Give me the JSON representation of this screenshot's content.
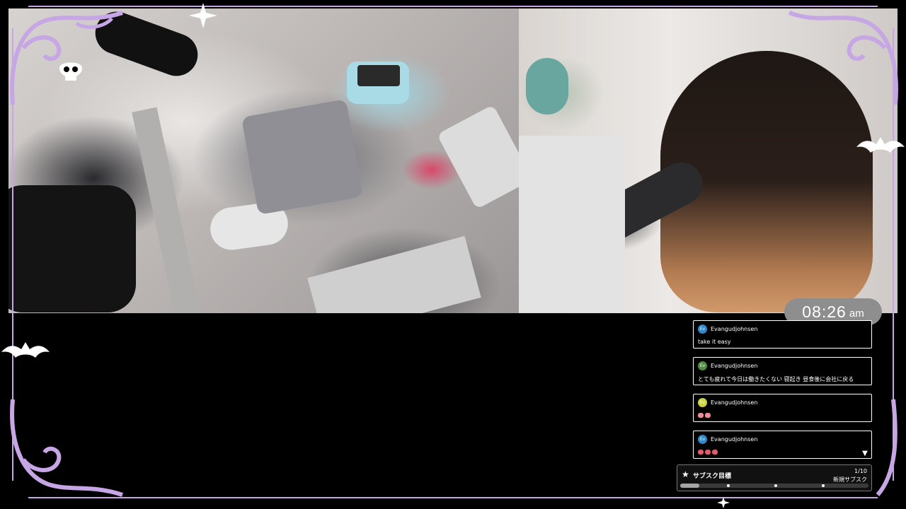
{
  "overlay": {
    "frame_color": "#c6a6e4",
    "accent_colors": [
      "#c6a6e4",
      "#ffffff"
    ],
    "icons": [
      "skull-icon",
      "bat-icon",
      "sparkle-icon",
      "swirl-ornament"
    ]
  },
  "clock": {
    "time": "08:26",
    "ampm": "am"
  },
  "chat": {
    "messages": [
      {
        "initials": "Ev",
        "avatar_color": "#2d89c9",
        "user": "Evangudjohnsen",
        "text": "take it easy"
      },
      {
        "initials": "Ev",
        "avatar_color": "#4f8a3f",
        "user": "Evangudjohnsen",
        "text": "とても疲れて今日は働きたくない 寝起き 昼食後に会社に戻る"
      },
      {
        "initials": "Ev",
        "avatar_color": "#c9d33a",
        "user": "Evangudjohnsen",
        "emote_color": "#f08aa0",
        "emote_count": 2
      },
      {
        "initials": "Ev",
        "avatar_color": "#2d89c9",
        "user": "Evangudjohnsen",
        "emote_color": "#e25b6a",
        "emote_count": 3
      }
    ]
  },
  "sub_goal": {
    "label": "サブスク目標",
    "count": "1/10",
    "type": "新規サブスク",
    "progress": 0.1
  }
}
